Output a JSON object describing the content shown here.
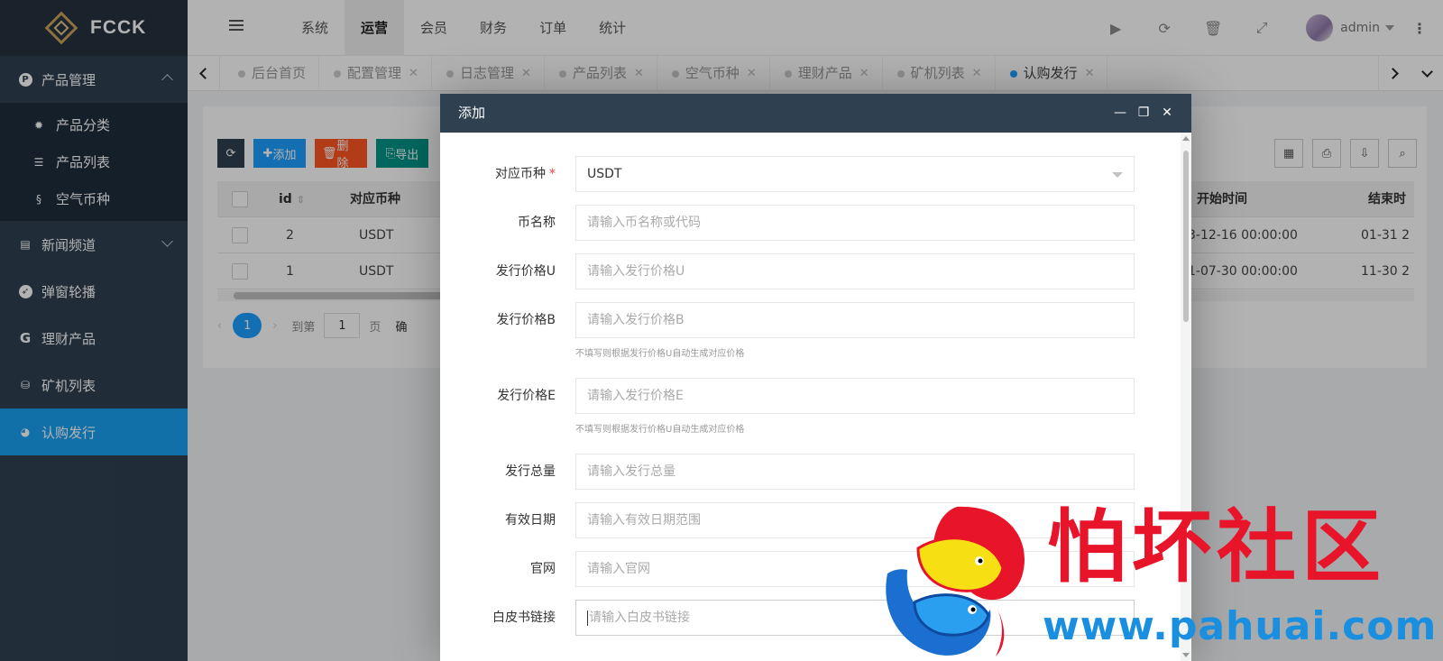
{
  "app": {
    "logo_text": "FCCK"
  },
  "sidebar": {
    "groups": [
      {
        "label": "产品管理",
        "icon": "circle-p-icon",
        "expanded": true,
        "items": [
          {
            "label": "产品分类",
            "icon": "gear-icon"
          },
          {
            "label": "产品列表",
            "icon": "list-icon"
          },
          {
            "label": "空气币种",
            "icon": "coin-icon"
          }
        ]
      },
      {
        "label": "新闻频道",
        "icon": "newspaper-icon",
        "expanded": false
      },
      {
        "label": "弹窗轮播",
        "icon": "compass-icon"
      },
      {
        "label": "理财产品",
        "icon": "g-letter-icon"
      },
      {
        "label": "矿机列表",
        "icon": "cubes-icon"
      },
      {
        "label": "认购发行",
        "icon": "pie-chart-icon",
        "active": true
      }
    ]
  },
  "header": {
    "nav": [
      "系统",
      "运营",
      "会员",
      "财务",
      "订单",
      "统计"
    ],
    "active_nav": "运营",
    "user_name": "admin",
    "tool_glyphs": {
      "play": "▶",
      "refresh": "⟳",
      "trash": "🗑",
      "fullscreen": "⤢",
      "more": "⋮"
    }
  },
  "tabs": [
    {
      "label": "后台首页",
      "closable": false
    },
    {
      "label": "配置管理",
      "closable": true
    },
    {
      "label": "日志管理",
      "closable": true
    },
    {
      "label": "产品列表",
      "closable": true
    },
    {
      "label": "空气币种",
      "closable": true
    },
    {
      "label": "理财产品",
      "closable": true
    },
    {
      "label": "矿机列表",
      "closable": true
    },
    {
      "label": "认购发行",
      "closable": true,
      "active": true
    }
  ],
  "content": {
    "buttons": {
      "add": "添加",
      "delete": "删除",
      "export": "导出"
    },
    "table": {
      "headers": {
        "id": "id",
        "coin": "对应币种",
        "start": "开始时间",
        "end": "结束时"
      },
      "rows": [
        {
          "id": "2",
          "coin": "USDT",
          "start": "3-12-16 00:00:00",
          "end": "01-31 2"
        },
        {
          "id": "1",
          "coin": "USDT",
          "start": "1-07-30 00:00:00",
          "end": "11-30 2"
        }
      ]
    },
    "pager": {
      "current": "1",
      "goto_label": "到第",
      "goto_value": "1",
      "page_unit": "页",
      "confirm": "确"
    }
  },
  "dialog": {
    "title": "添加",
    "fields": [
      {
        "label": "对应币种",
        "required": true,
        "type": "select",
        "value": "USDT"
      },
      {
        "label": "币名称",
        "placeholder": "请输入币名称或代码"
      },
      {
        "label": "发行价格U",
        "placeholder": "请输入发行价格U"
      },
      {
        "label": "发行价格B",
        "placeholder": "请输入发行价格B",
        "hint": "不填写则根据发行价格U自动生成对应价格"
      },
      {
        "label": "发行价格E",
        "placeholder": "请输入发行价格E",
        "hint": "不填写则根据发行价格U自动生成对应价格"
      },
      {
        "label": "发行总量",
        "placeholder": "请输入发行总量"
      },
      {
        "label": "有效日期",
        "placeholder": "请输入有效日期范围"
      },
      {
        "label": "官网",
        "placeholder": "请输入官网"
      },
      {
        "label": "白皮书链接",
        "placeholder": "请输入白皮书链接"
      }
    ]
  },
  "watermark": {
    "text": "怕坏社区",
    "url": "www.pahuai.com"
  }
}
